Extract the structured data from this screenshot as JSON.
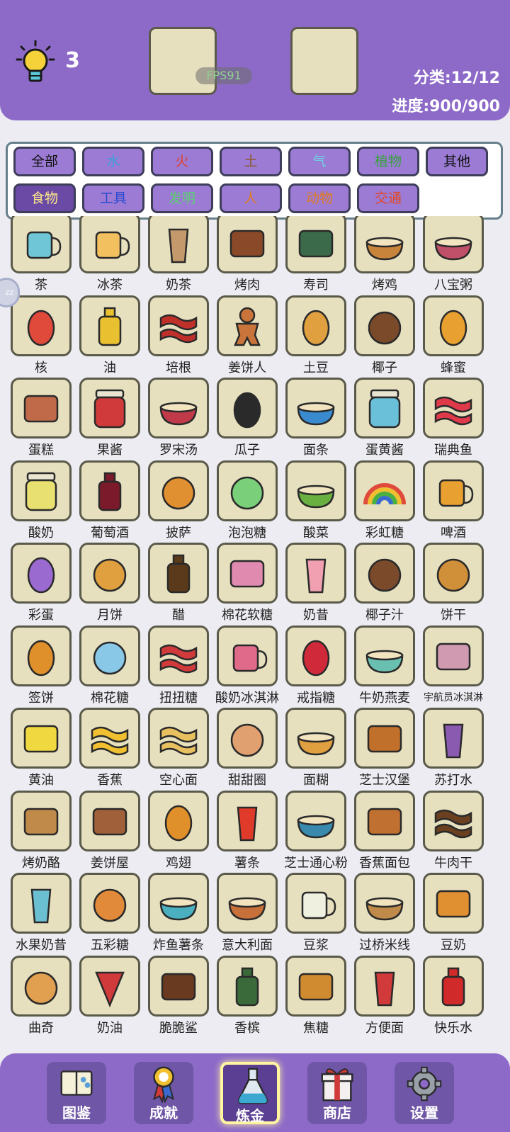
{
  "header": {
    "hint_count": "3",
    "fps": "FPS91",
    "category": "分类:12/12",
    "progress": "进度:900/900"
  },
  "filters": [
    {
      "label": "全部",
      "color": "#111111"
    },
    {
      "label": "水",
      "color": "#3aa0d8"
    },
    {
      "label": "火",
      "color": "#e0402a"
    },
    {
      "label": "土",
      "color": "#8a5a2a"
    },
    {
      "label": "气",
      "color": "#6fd0e0"
    },
    {
      "label": "植物",
      "color": "#3aa040"
    },
    {
      "label": "其他",
      "color": "#111111"
    },
    {
      "label": "食物",
      "color": "#ffe98a",
      "active": true
    },
    {
      "label": "工具",
      "color": "#2a4ad0"
    },
    {
      "label": "发明",
      "color": "#5ad070"
    },
    {
      "label": "人",
      "color": "#e07a20"
    },
    {
      "label": "动物",
      "color": "#e07a20"
    },
    {
      "label": "交通",
      "color": "#e04a2a"
    }
  ],
  "items": [
    {
      "label": "茶",
      "icon": "cup-icon",
      "color": "#6fc6d6"
    },
    {
      "label": "冰茶",
      "icon": "pitcher-icon",
      "color": "#f3c060"
    },
    {
      "label": "奶茶",
      "icon": "bubble-tea-icon",
      "color": "#c49a6c"
    },
    {
      "label": "烤肉",
      "icon": "steak-icon",
      "color": "#8a4a2a"
    },
    {
      "label": "寿司",
      "icon": "sushi-icon",
      "color": "#3a6a4a"
    },
    {
      "label": "烤鸡",
      "icon": "roast-chicken-icon",
      "color": "#c8843a"
    },
    {
      "label": "八宝粥",
      "icon": "porridge-icon",
      "color": "#c0506a"
    },
    {
      "label": "核",
      "icon": "apple-core-icon",
      "color": "#e04a3a"
    },
    {
      "label": "油",
      "icon": "oil-bottle-icon",
      "color": "#e8c030"
    },
    {
      "label": "培根",
      "icon": "bacon-icon",
      "color": "#c0302a"
    },
    {
      "label": "姜饼人",
      "icon": "gingerbread-man-icon",
      "color": "#c8743a"
    },
    {
      "label": "土豆",
      "icon": "potato-icon",
      "color": "#e0a040"
    },
    {
      "label": "椰子",
      "icon": "coconut-icon",
      "color": "#7a4a2a"
    },
    {
      "label": "蜂蜜",
      "icon": "honey-dipper-icon",
      "color": "#e8a030"
    },
    {
      "label": "蛋糕",
      "icon": "cake-icon",
      "color": "#c06a4a"
    },
    {
      "label": "果酱",
      "icon": "jam-jar-icon",
      "color": "#d03a3a"
    },
    {
      "label": "罗宋汤",
      "icon": "borscht-icon",
      "color": "#c03a4a"
    },
    {
      "label": "瓜子",
      "icon": "sunflower-seeds-icon",
      "color": "#2a2a2a"
    },
    {
      "label": "面条",
      "icon": "noodle-bowl-icon",
      "color": "#3a8ad0"
    },
    {
      "label": "蛋黄酱",
      "icon": "mayo-jar-icon",
      "color": "#6ac0d8"
    },
    {
      "label": "瑞典鱼",
      "icon": "swedish-fish-icon",
      "color": "#e03a4a"
    },
    {
      "label": "酸奶",
      "icon": "yogurt-icon",
      "color": "#e8e070"
    },
    {
      "label": "葡萄酒",
      "icon": "wine-bottle-icon",
      "color": "#7a1a2a"
    },
    {
      "label": "披萨",
      "icon": "pizza-icon",
      "color": "#e09030"
    },
    {
      "label": "泡泡糖",
      "icon": "gumballs-icon",
      "color": "#7ad07a"
    },
    {
      "label": "酸菜",
      "icon": "pickled-cabbage-icon",
      "color": "#6ab040"
    },
    {
      "label": "彩虹糖",
      "icon": "rainbow-icon",
      "color": "#e04a3a"
    },
    {
      "label": "啤酒",
      "icon": "beer-mug-icon",
      "color": "#e8a030"
    },
    {
      "label": "彩蛋",
      "icon": "easter-egg-icon",
      "color": "#9a6ad0"
    },
    {
      "label": "月饼",
      "icon": "mooncake-icon",
      "color": "#e0a040"
    },
    {
      "label": "醋",
      "icon": "vinegar-jug-icon",
      "color": "#5a3a1a"
    },
    {
      "label": "棉花软糖",
      "icon": "marshmallow-icon",
      "color": "#e08ab0"
    },
    {
      "label": "奶昔",
      "icon": "milkshake-icon",
      "color": "#f0a0b0"
    },
    {
      "label": "椰子汁",
      "icon": "coconut-drink-icon",
      "color": "#7a4a2a"
    },
    {
      "label": "饼干",
      "icon": "cookie-icon",
      "color": "#d0903a"
    },
    {
      "label": "签饼",
      "icon": "fortune-cookie-icon",
      "color": "#e0902a"
    },
    {
      "label": "棉花糖",
      "icon": "cotton-candy-icon",
      "color": "#8ac8e8"
    },
    {
      "label": "扭扭糖",
      "icon": "twist-candy-icon",
      "color": "#d03a3a"
    },
    {
      "label": "酸奶冰淇淋",
      "icon": "frozen-yogurt-icon",
      "color": "#e06a8a"
    },
    {
      "label": "戒指糖",
      "icon": "ring-pop-icon",
      "color": "#d02a3a"
    },
    {
      "label": "牛奶燕麦",
      "icon": "oatmeal-bowl-icon",
      "color": "#6ac0b0"
    },
    {
      "label": "宇航员冰淇淋",
      "icon": "astronaut-ice-cream-icon",
      "color": "#d09ab0",
      "small": true
    },
    {
      "label": "黄油",
      "icon": "butter-icon",
      "color": "#f0d840"
    },
    {
      "label": "香蕉",
      "icon": "banana-icon",
      "color": "#f0c030"
    },
    {
      "label": "空心面",
      "icon": "macaroni-icon",
      "color": "#e8c060"
    },
    {
      "label": "甜甜圈",
      "icon": "donut-icon",
      "color": "#e0a070"
    },
    {
      "label": "面糊",
      "icon": "batter-bowl-icon",
      "color": "#e0a040"
    },
    {
      "label": "芝士汉堡",
      "icon": "cheeseburger-icon",
      "color": "#c0702a"
    },
    {
      "label": "苏打水",
      "icon": "soda-cup-icon",
      "color": "#8a5ab0"
    },
    {
      "label": "烤奶酪",
      "icon": "grilled-cheese-icon",
      "color": "#c08a4a"
    },
    {
      "label": "姜饼屋",
      "icon": "gingerbread-house-icon",
      "color": "#a0603a"
    },
    {
      "label": "鸡翅",
      "icon": "chicken-wing-icon",
      "color": "#e0902a"
    },
    {
      "label": "薯条",
      "icon": "fries-icon",
      "color": "#e03a2a"
    },
    {
      "label": "芝士通心粉",
      "icon": "mac-cheese-icon",
      "color": "#3a8ab0"
    },
    {
      "label": "香蕉面包",
      "icon": "banana-bread-icon",
      "color": "#c07030"
    },
    {
      "label": "牛肉干",
      "icon": "jerky-icon",
      "color": "#6a4020"
    },
    {
      "label": "水果奶昔",
      "icon": "smoothie-icon",
      "color": "#6ac0d0"
    },
    {
      "label": "五彩糖",
      "icon": "sprinkles-icon",
      "color": "#e08a3a"
    },
    {
      "label": "炸鱼薯条",
      "icon": "fish-and-chips-icon",
      "color": "#4ab0c0"
    },
    {
      "label": "意大利面",
      "icon": "spaghetti-icon",
      "color": "#c8703a"
    },
    {
      "label": "豆浆",
      "icon": "soy-milk-icon",
      "color": "#f0f0e0"
    },
    {
      "label": "过桥米线",
      "icon": "rice-noodle-icon",
      "color": "#c08a4a"
    },
    {
      "label": "豆奶",
      "icon": "soy-milk-pack-icon",
      "color": "#e09030"
    },
    {
      "label": "曲奇",
      "icon": "chocolate-chip-cookie-icon",
      "color": "#e0a050"
    },
    {
      "label": "奶油",
      "icon": "piping-bag-icon",
      "color": "#d03a3a"
    },
    {
      "label": "脆脆鲨",
      "icon": "wafer-bar-icon",
      "color": "#6a3a20"
    },
    {
      "label": "香槟",
      "icon": "champagne-icon",
      "color": "#3a6a3a"
    },
    {
      "label": "焦糖",
      "icon": "caramel-icon",
      "color": "#d08a30"
    },
    {
      "label": "方便面",
      "icon": "cup-noodles-icon",
      "color": "#d03a3a"
    },
    {
      "label": "快乐水",
      "icon": "cola-can-icon",
      "color": "#d02a2a"
    }
  ],
  "nav": [
    {
      "label": "图鉴",
      "icon": "book-icon"
    },
    {
      "label": "成就",
      "icon": "medal-icon"
    },
    {
      "label": "炼金",
      "icon": "flask-icon",
      "active": true
    },
    {
      "label": "商店",
      "icon": "gift-icon"
    },
    {
      "label": "设置",
      "icon": "gear-icon"
    }
  ]
}
